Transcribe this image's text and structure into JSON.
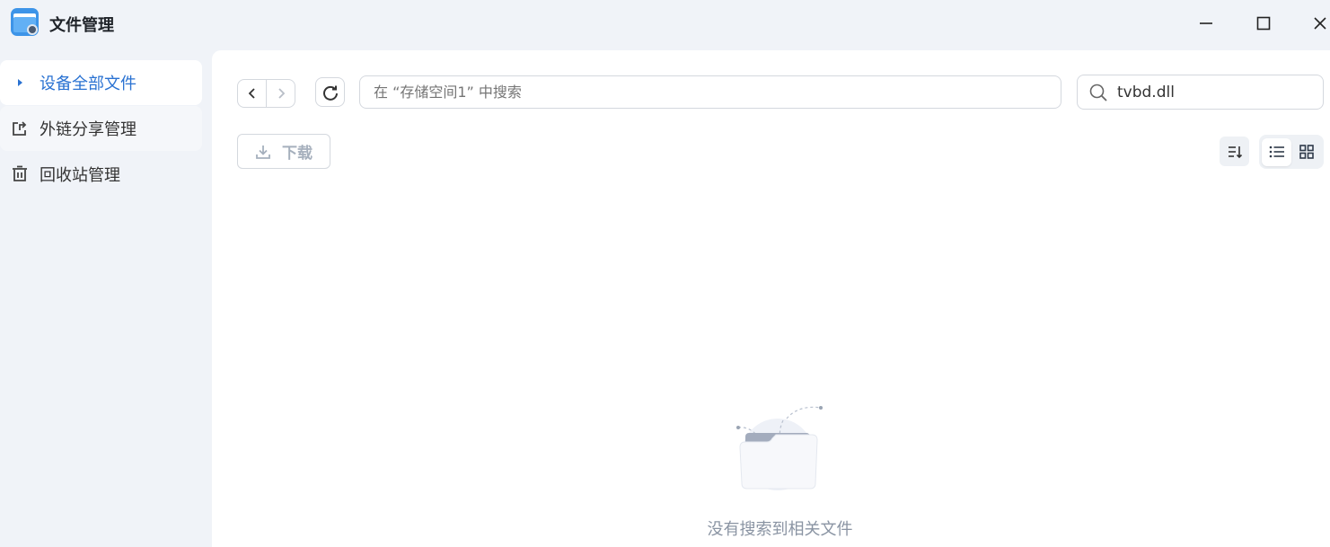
{
  "app": {
    "title": "文件管理",
    "icon": "file-manager-app-icon"
  },
  "window_controls": {
    "minimize_icon": "minimize-icon",
    "maximize_icon": "maximize-icon",
    "close_icon": "close-icon"
  },
  "sidebar": {
    "items": [
      {
        "label": "设备全部文件",
        "icon": "caret-right-icon",
        "active": true
      },
      {
        "label": "外链分享管理",
        "icon": "share-icon",
        "active": false
      },
      {
        "label": "回收站管理",
        "icon": "trash-icon",
        "active": false
      }
    ]
  },
  "toolbar": {
    "path_placeholder": "在 “存储空间1” 中搜索",
    "search_value": "tvbd.dll",
    "download_label": "下载"
  },
  "empty_state": {
    "message": "没有搜索到相关文件"
  },
  "colors": {
    "accent": "#2a72d2",
    "background": "#f0f3f8",
    "panel": "#ffffff",
    "muted_text": "#8a94a3"
  }
}
